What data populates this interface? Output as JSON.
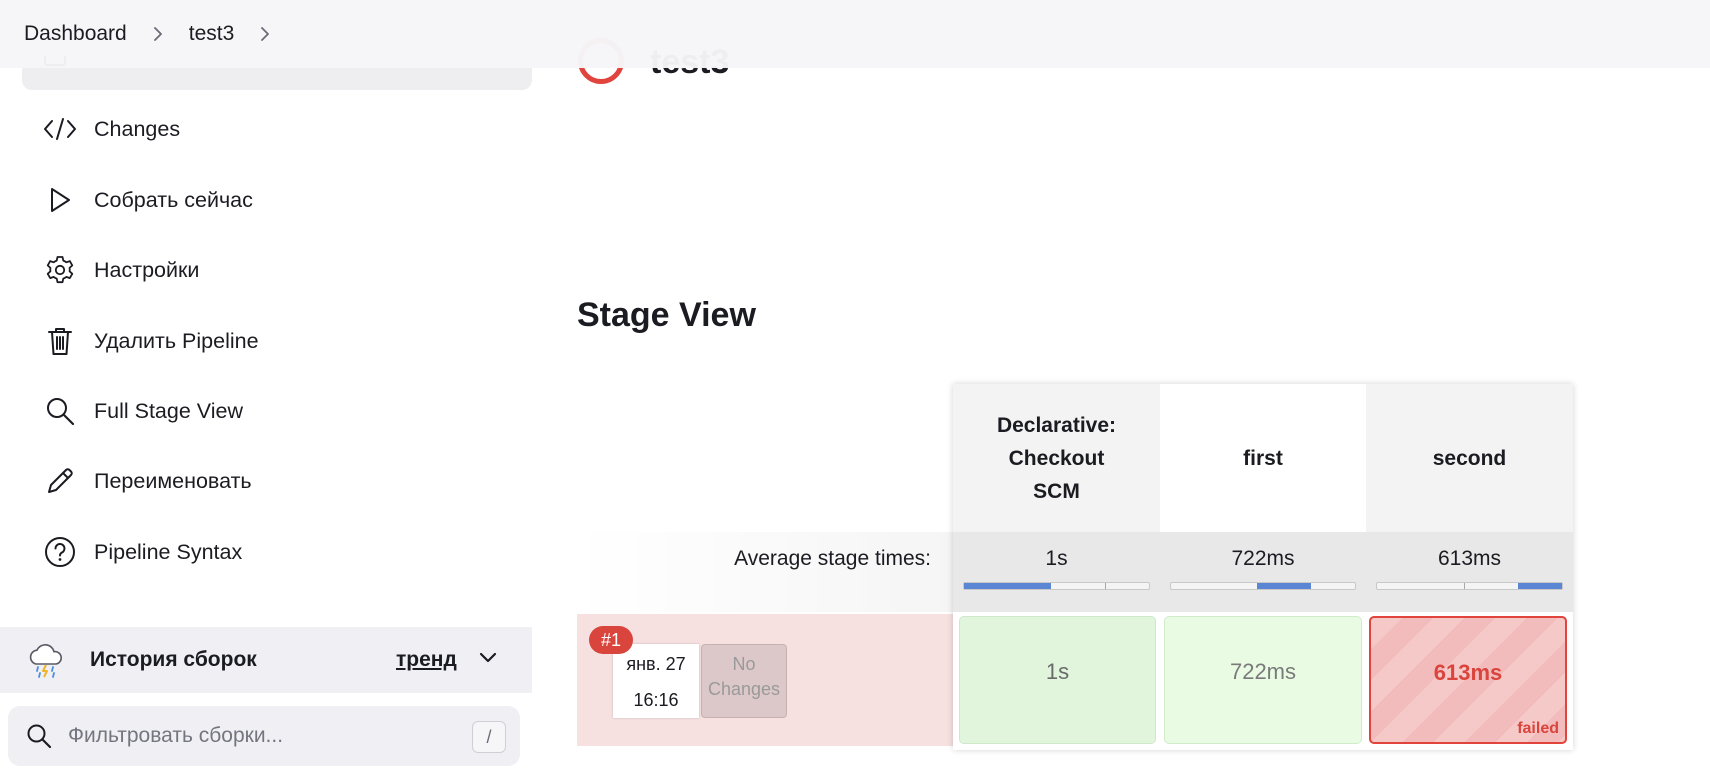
{
  "breadcrumb": {
    "items": [
      "Dashboard",
      "test3"
    ]
  },
  "sidebar": {
    "items": [
      {
        "label": "Changes",
        "icon": "code-icon"
      },
      {
        "label": "Собрать сейчас",
        "icon": "play-icon"
      },
      {
        "label": "Настройки",
        "icon": "gear-icon"
      },
      {
        "label": "Удалить Pipeline",
        "icon": "trash-icon"
      },
      {
        "label": "Full Stage View",
        "icon": "search-icon"
      },
      {
        "label": "Переименовать",
        "icon": "pencil-icon"
      },
      {
        "label": "Pipeline Syntax",
        "icon": "help-icon"
      }
    ]
  },
  "history": {
    "title": "История сборок",
    "trend": "тренд",
    "icon": "weather-storm-icon"
  },
  "filter": {
    "placeholder": "Фильтровать сборки...",
    "shortcut": "/"
  },
  "job": {
    "name": "test3",
    "status_color": "#e0443c"
  },
  "stage_view": {
    "title": "Stage View",
    "stages": [
      {
        "name_lines": [
          "Declarative:",
          "Checkout",
          "SCM"
        ]
      },
      {
        "name_lines": [
          "first"
        ]
      },
      {
        "name_lines": [
          "second"
        ]
      }
    ],
    "average_label": "Average stage times:",
    "averages": [
      "1s",
      "722ms",
      "613ms"
    ],
    "build": {
      "number": "#1",
      "date": "янв. 27",
      "time": "16:16",
      "changes_line1": "No",
      "changes_line2": "Changes",
      "results": [
        {
          "value": "1s",
          "status": "success"
        },
        {
          "value": "722ms",
          "status": "success"
        },
        {
          "value": "613ms",
          "status": "failed",
          "status_label": "failed"
        }
      ]
    }
  },
  "colors": {
    "failed": "#d9443c",
    "success_bg": "#e1f5dd",
    "progress": "#5b86d4"
  }
}
